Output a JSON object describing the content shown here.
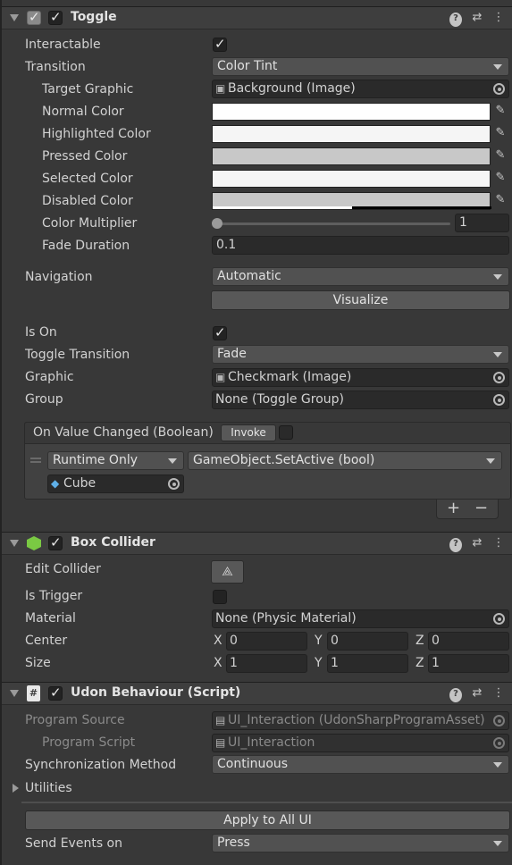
{
  "toggle": {
    "title": "Toggle",
    "interactable_label": "Interactable",
    "transition_label": "Transition",
    "transition_value": "Color Tint",
    "target_graphic_label": "Target Graphic",
    "target_graphic_value": "Background (Image)",
    "normal_color_label": "Normal Color",
    "highlighted_color_label": "Highlighted Color",
    "pressed_color_label": "Pressed Color",
    "selected_color_label": "Selected Color",
    "disabled_color_label": "Disabled Color",
    "color_multiplier_label": "Color Multiplier",
    "color_multiplier_value": "1",
    "fade_duration_label": "Fade Duration",
    "fade_duration_value": "0.1",
    "navigation_label": "Navigation",
    "navigation_value": "Automatic",
    "visualize_label": "Visualize",
    "is_on_label": "Is On",
    "toggle_transition_label": "Toggle Transition",
    "toggle_transition_value": "Fade",
    "graphic_label": "Graphic",
    "graphic_value": "Checkmark (Image)",
    "group_label": "Group",
    "group_value": "None (Toggle Group)",
    "event_title": "On Value Changed (Boolean)",
    "invoke_label": "Invoke",
    "runtime_value": "Runtime Only",
    "function_value": "GameObject.SetActive (bool)",
    "target_object_value": "Cube",
    "plus_label": "+",
    "minus_label": "−",
    "colors": {
      "normal": "#ffffff",
      "highlighted": "#f5f5f5",
      "pressed": "#c8c8c8",
      "selected": "#f5f5f5",
      "disabled": "#c8c8c8"
    }
  },
  "box_collider": {
    "title": "Box Collider",
    "edit_collider_label": "Edit Collider",
    "is_trigger_label": "Is Trigger",
    "material_label": "Material",
    "material_value": "None (Physic Material)",
    "center_label": "Center",
    "size_label": "Size",
    "x_label": "X",
    "y_label": "Y",
    "z_label": "Z",
    "center": {
      "x": "0",
      "y": "0",
      "z": "0"
    },
    "size": {
      "x": "1",
      "y": "1",
      "z": "1"
    }
  },
  "udon": {
    "title": "Udon Behaviour (Script)",
    "program_source_label": "Program Source",
    "program_source_value": "UI_Interaction (UdonSharpProgramAsset)",
    "program_script_label": "Program Script",
    "program_script_value": "UI_Interaction",
    "sync_method_label": "Synchronization Method",
    "sync_method_value": "Continuous",
    "utilities_label": "Utilities",
    "apply_label": "Apply to All UI",
    "send_events_label": "Send Events on",
    "send_events_value": "Press"
  }
}
